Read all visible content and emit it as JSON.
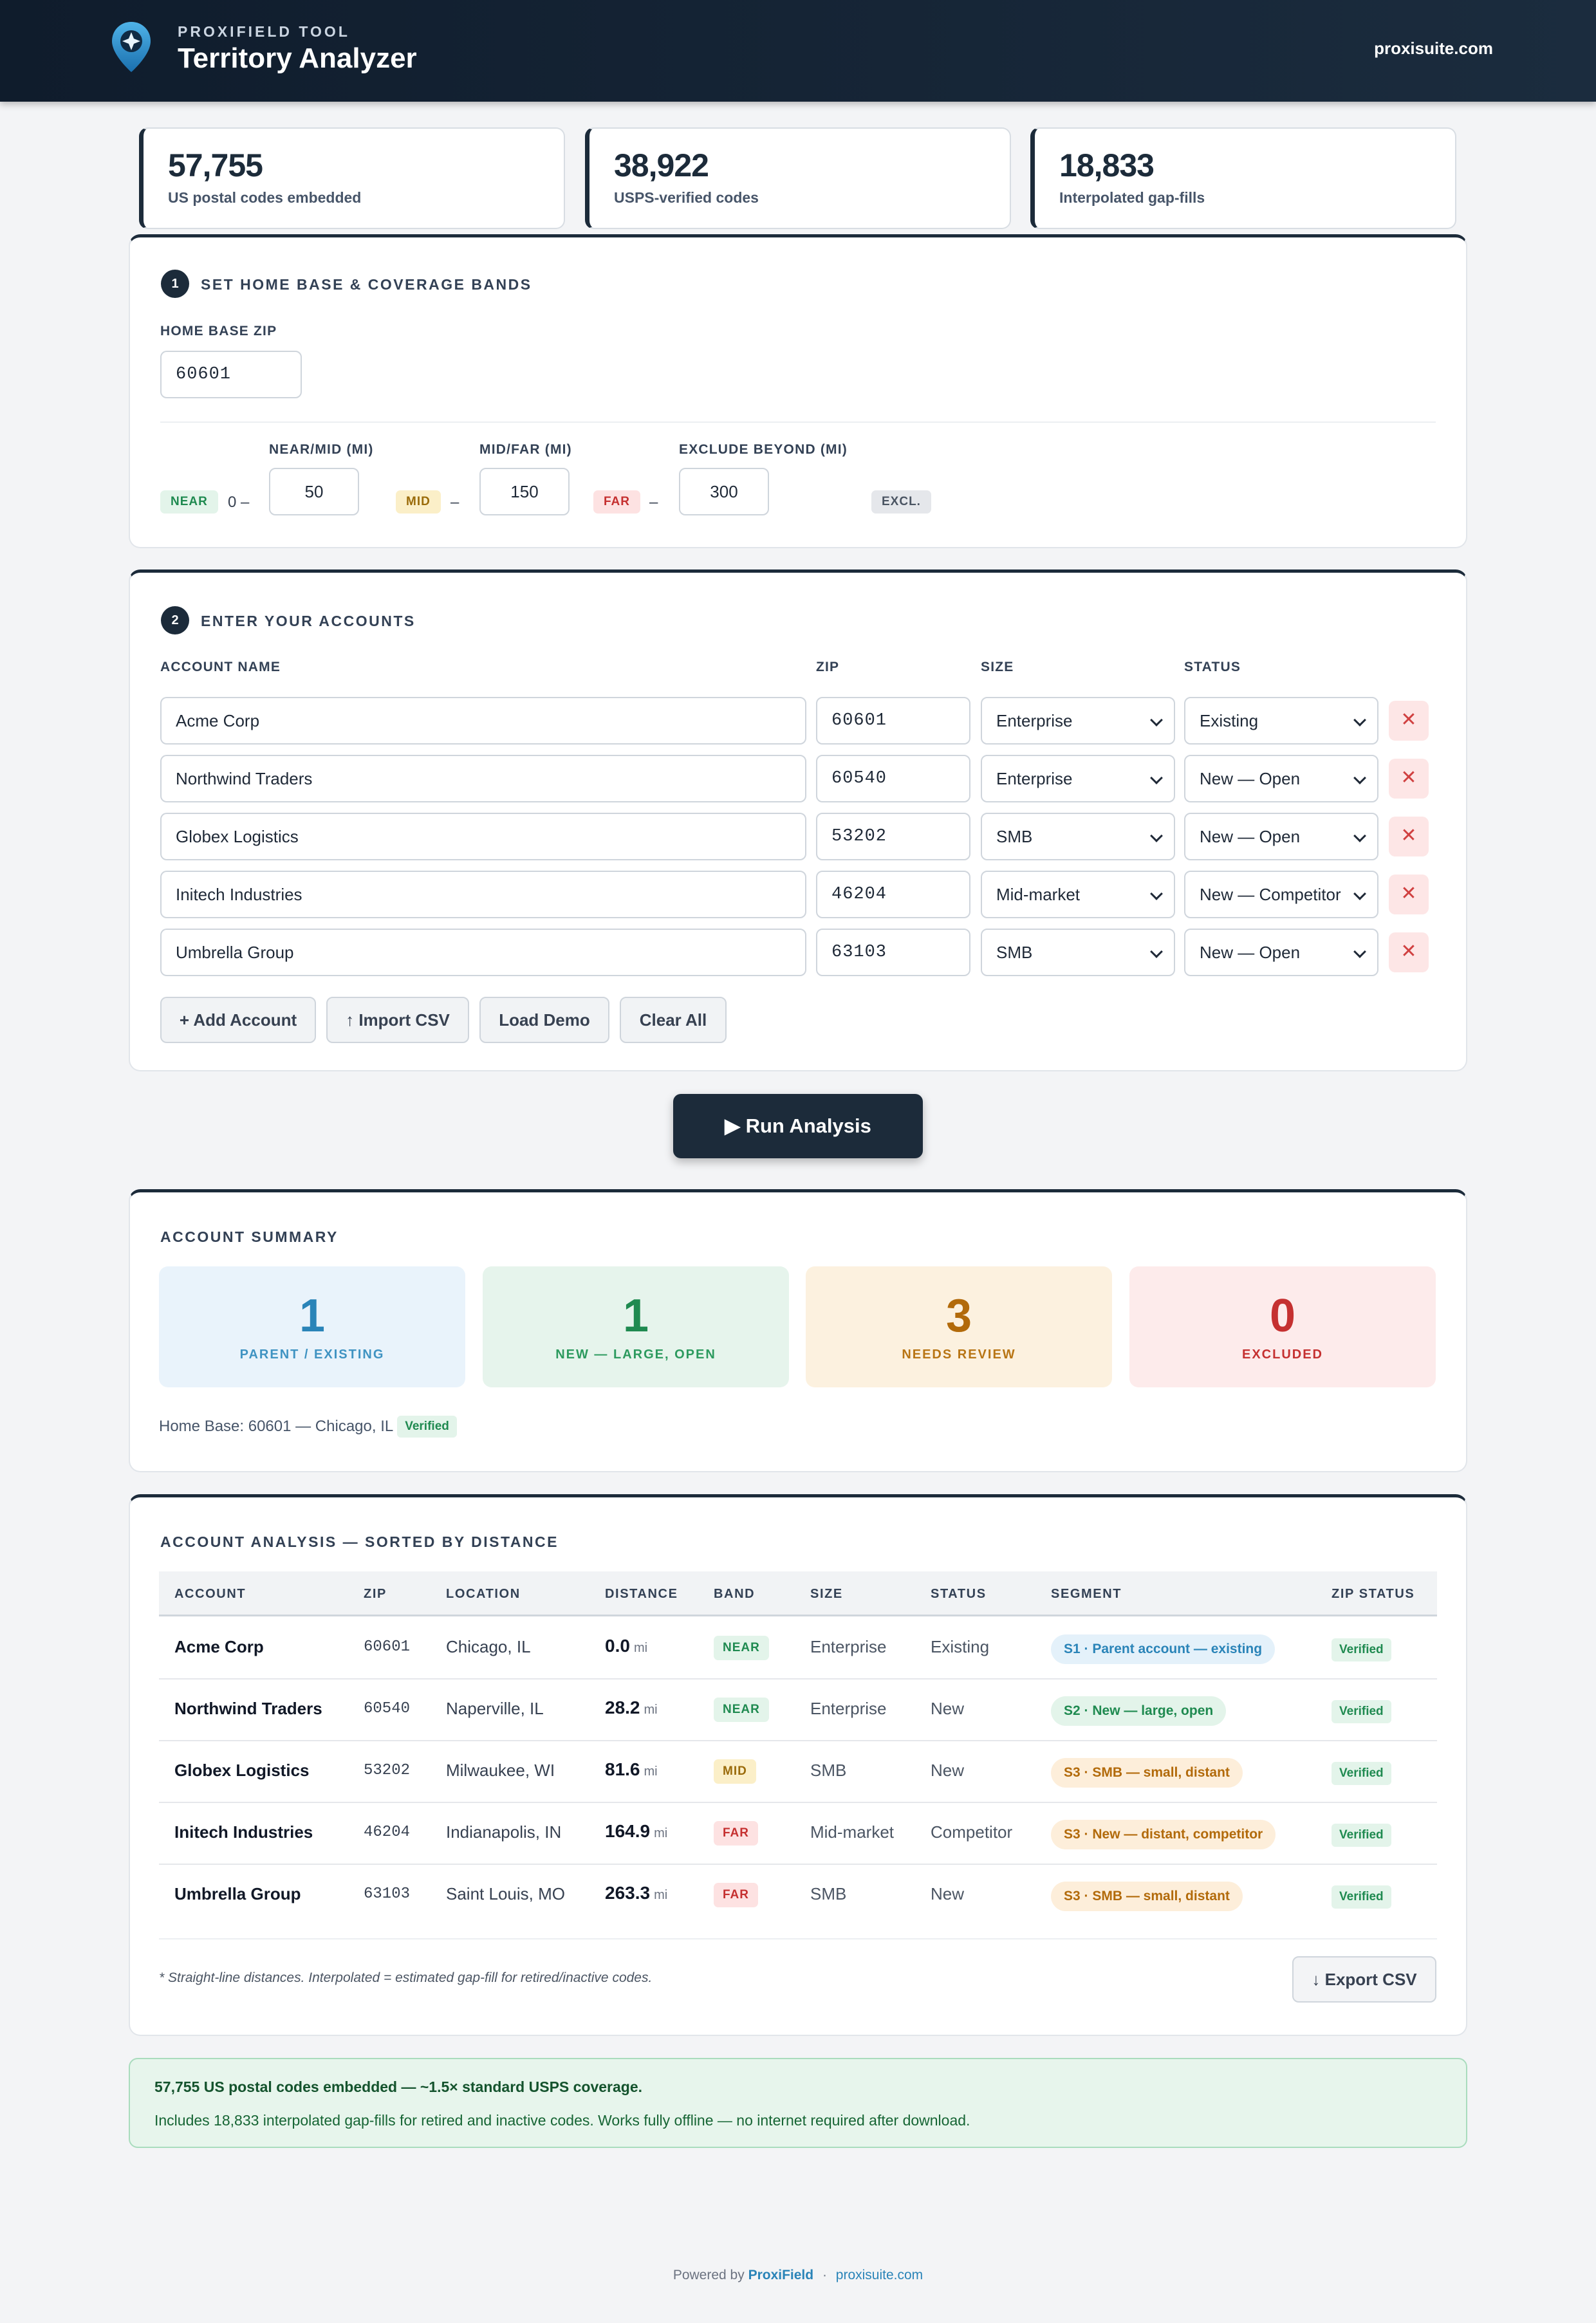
{
  "header": {
    "subtitle": "PROXIFIELD TOOL",
    "title": "Territory Analyzer",
    "site": "proxisuite.com"
  },
  "stats": [
    {
      "value": "57,755",
      "label": "US postal codes embedded"
    },
    {
      "value": "38,922",
      "label": "USPS-verified codes"
    },
    {
      "value": "18,833",
      "label": "Interpolated gap-fills"
    }
  ],
  "step1": {
    "number": "1",
    "title": "SET HOME BASE & COVERAGE BANDS",
    "home_label": "HOME BASE ZIP",
    "home_value": "60601",
    "near_mid_label": "NEAR/MID (MI)",
    "near_mid_value": "50",
    "mid_far_label": "MID/FAR (MI)",
    "mid_far_value": "150",
    "exclude_label": "EXCLUDE BEYOND (MI)",
    "exclude_value": "300",
    "near_badge": "NEAR",
    "near_range": "0 –",
    "mid_badge": "MID",
    "mid_range": "–",
    "far_badge": "FAR",
    "far_range": "–",
    "excl_badge": "EXCL."
  },
  "step2": {
    "number": "2",
    "title": "ENTER YOUR ACCOUNTS",
    "col_name": "ACCOUNT NAME",
    "col_zip": "ZIP",
    "col_size": "SIZE",
    "col_status": "STATUS",
    "rows": [
      {
        "name": "Acme Corp",
        "zip": "60601",
        "size": "Enterprise",
        "status": "Existing"
      },
      {
        "name": "Northwind Traders",
        "zip": "60540",
        "size": "Enterprise",
        "status": "New — Open"
      },
      {
        "name": "Globex Logistics",
        "zip": "53202",
        "size": "SMB",
        "status": "New — Open"
      },
      {
        "name": "Initech Industries",
        "zip": "46204",
        "size": "Mid-market",
        "status": "New — Competitor"
      },
      {
        "name": "Umbrella Group",
        "zip": "63103",
        "size": "SMB",
        "status": "New — Open"
      }
    ],
    "delete_label": "✕",
    "add_label": "+ Add Account",
    "import_label": "↑ Import CSV",
    "demo_label": "Load Demo",
    "clear_label": "Clear All"
  },
  "run_label": "▶  Run Analysis",
  "summary": {
    "title": "ACCOUNT SUMMARY",
    "boxes": [
      {
        "value": "1",
        "label": "PARENT / EXISTING"
      },
      {
        "value": "1",
        "label": "NEW — LARGE, OPEN"
      },
      {
        "value": "3",
        "label": "NEEDS REVIEW"
      },
      {
        "value": "0",
        "label": "EXCLUDED"
      }
    ],
    "home_base": "Home Base: 60601 — Chicago, IL",
    "verified": "Verified"
  },
  "analysis": {
    "title": "ACCOUNT ANALYSIS — SORTED BY DISTANCE",
    "headers": [
      "ACCOUNT",
      "ZIP",
      "LOCATION",
      "DISTANCE",
      "BAND",
      "SIZE",
      "STATUS",
      "SEGMENT",
      "ZIP STATUS"
    ],
    "unit": "mi",
    "rows": [
      {
        "account": "Acme Corp",
        "zip": "60601",
        "location": "Chicago, IL",
        "distance": "0.0",
        "band": "NEAR",
        "size": "Enterprise",
        "status": "Existing",
        "segment": "S1 · Parent account — existing",
        "zip_status": "Verified"
      },
      {
        "account": "Northwind Traders",
        "zip": "60540",
        "location": "Naperville, IL",
        "distance": "28.2",
        "band": "NEAR",
        "size": "Enterprise",
        "status": "New",
        "segment": "S2 · New — large, open",
        "zip_status": "Verified"
      },
      {
        "account": "Globex Logistics",
        "zip": "53202",
        "location": "Milwaukee, WI",
        "distance": "81.6",
        "band": "MID",
        "size": "SMB",
        "status": "New",
        "segment": "S3 · SMB — small, distant",
        "zip_status": "Verified"
      },
      {
        "account": "Initech Industries",
        "zip": "46204",
        "location": "Indianapolis, IN",
        "distance": "164.9",
        "band": "FAR",
        "size": "Mid-market",
        "status": "Competitor",
        "segment": "S3 · New — distant, competitor",
        "zip_status": "Verified"
      },
      {
        "account": "Umbrella Group",
        "zip": "63103",
        "location": "Saint Louis, MO",
        "distance": "263.3",
        "band": "FAR",
        "size": "SMB",
        "status": "New",
        "segment": "S3 · SMB — small, distant",
        "zip_status": "Verified"
      }
    ],
    "note": "* Straight-line distances. Interpolated = estimated gap-fill for retired/inactive codes.",
    "export_label": "↓ Export CSV"
  },
  "banner": {
    "line1": "57,755 US postal codes embedded — ~1.5× standard USPS coverage.",
    "line2": "Includes 18,833 interpolated gap-fills for retired and inactive codes. Works fully offline — no internet required after download."
  },
  "footer": {
    "prefix": "Powered by",
    "brand": "ProxiField",
    "sep": "·",
    "site": "proxisuite.com"
  },
  "colors": {
    "navy": "#1c2b3a",
    "near": "#1f8a50",
    "mid": "#9a6b0a",
    "far": "#c53030",
    "existing": "#2a84b8",
    "review": "#b26a0a"
  },
  "icons": {
    "logo": "map-pin-compass-icon",
    "delete": "close-icon",
    "select": "chevron-down-icon"
  }
}
